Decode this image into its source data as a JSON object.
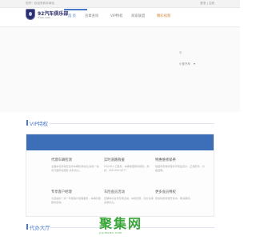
{
  "topbar": {
    "welcome": "您好！欢迎来到本网站",
    "auth": "登录 | 注册"
  },
  "brand": {
    "name": "92汽车俱乐部",
    "url": "92qc.com",
    "color": "#2b2f6b"
  },
  "nav": {
    "items": [
      {
        "label": "首 页",
        "active": true
      },
      {
        "label": "违章查询"
      },
      {
        "label": "VIP特权"
      },
      {
        "label": "商家联盟"
      },
      {
        "label": "精彩视频"
      }
    ],
    "accent": "#4a78c8"
  },
  "banner": {
    "ghost_text": "车",
    "select_value": "小型汽车"
  },
  "vip": {
    "title": "VIP特权",
    "cells": [
      {
        "name": "代理车辆检测",
        "desc": "全国车管所指定合作车辆检测站点,提供一站式代理年检服务,省时省心。"
      },
      {
        "name": "实时道路救援",
        "desc": "24小时人工服务，车辆故障随叫随到，热线：400-000-0077"
      },
      {
        "name": "特惠维修保养",
        "desc": "联盟商家维修保养享受会员价，正规配件，价格透明。"
      },
      {
        "name": "专享客户经理",
        "desc": "为您提供一对一专属客户经理服务，车辆问题随时咨询。"
      },
      {
        "name": "车险会员活动",
        "desc": "定期举办会员专属活动，车险优惠，积分兑换多重好礼。"
      },
      {
        "name": "更多会员特权",
        "desc": "更多特权持续开放中，敬请期待。"
      }
    ]
  },
  "hall": {
    "title": "代办大厅"
  },
  "watermark": {
    "text": "聚集网",
    "sub": "JUJIWANG.COM"
  }
}
